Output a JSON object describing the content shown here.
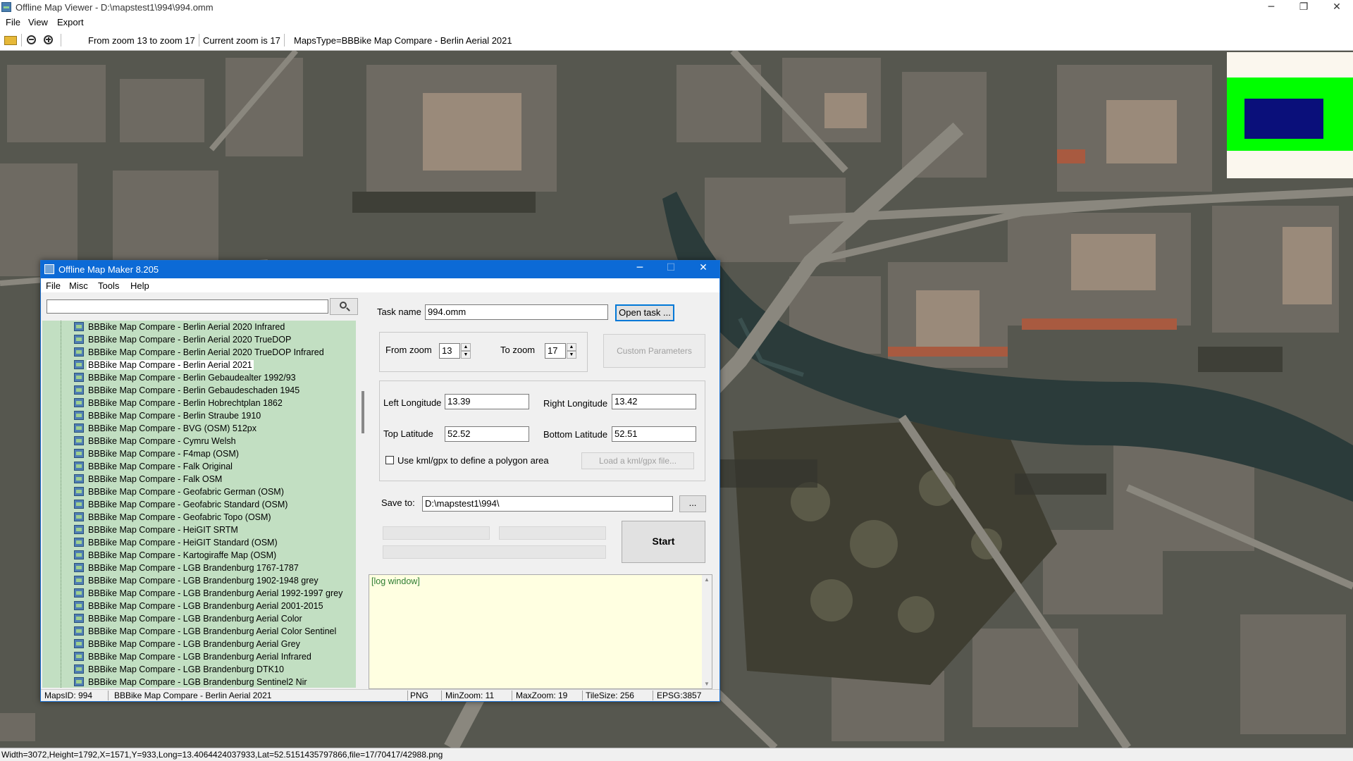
{
  "viewer": {
    "title": "Offline Map Viewer - D:\\mapstest1\\994\\994.omm",
    "menu": [
      "File",
      "View",
      "Export"
    ],
    "toolbar": {
      "zoom_range": "From zoom 13 to zoom 17",
      "current_zoom": "Current zoom is 17",
      "maps_type": "MapsType=BBBike Map Compare - Berlin Aerial 2021"
    },
    "status": "Width=3072,Height=1792,X=1571,Y=933,Long=13.4064424037933,Lat=52.5151435797866,file=17/70417/42988.png",
    "window_buttons": {
      "minimize": "─",
      "restore": "❐",
      "close": "✕"
    }
  },
  "minimap_colors": {
    "background": "#fbf7ee",
    "area": "#00ff00",
    "viewport": "#0a0f7a"
  },
  "omm": {
    "title": "Offline Map Maker 8.205",
    "menu": [
      "File",
      "Misc",
      "Tools",
      "Help"
    ],
    "search": {
      "value": ""
    },
    "tree_items": [
      "BBBike Map Compare - Berlin Aerial 2020 Infrared",
      "BBBike Map Compare - Berlin Aerial 2020 TrueDOP",
      "BBBike Map Compare - Berlin Aerial 2020 TrueDOP Infrared",
      "BBBike Map Compare - Berlin Aerial 2021",
      "BBBike Map Compare - Berlin Gebaudealter 1992/93",
      "BBBike Map Compare - Berlin Gebaudeschaden 1945",
      "BBBike Map Compare - Berlin Hobrechtplan 1862",
      "BBBike Map Compare - Berlin Straube 1910",
      "BBBike Map Compare - BVG (OSM) 512px",
      "BBBike Map Compare - Cymru Welsh",
      "BBBike Map Compare - F4map (OSM)",
      "BBBike Map Compare - Falk Original",
      "BBBike Map Compare - Falk OSM",
      "BBBike Map Compare - Geofabric German (OSM)",
      "BBBike Map Compare - Geofabric Standard (OSM)",
      "BBBike Map Compare - Geofabric Topo (OSM)",
      "BBBike Map Compare - HeiGIT SRTM",
      "BBBike Map Compare - HeiGIT Standard (OSM)",
      "BBBike Map Compare - Kartogiraffe Map (OSM)",
      "BBBike Map Compare - LGB Brandenburg 1767-1787",
      "BBBike Map Compare - LGB Brandenburg 1902-1948 grey",
      "BBBike Map Compare - LGB Brandenburg Aerial 1992-1997 grey",
      "BBBike Map Compare - LGB Brandenburg Aerial 2001-2015",
      "BBBike Map Compare - LGB Brandenburg Aerial Color",
      "BBBike Map Compare - LGB Brandenburg Aerial Color Sentinel",
      "BBBike Map Compare - LGB Brandenburg Aerial Grey",
      "BBBike Map Compare - LGB Brandenburg Aerial Infrared",
      "BBBike Map Compare - LGB Brandenburg DTK10",
      "BBBike Map Compare - LGB Brandenburg Sentinel2 Nir"
    ],
    "selected_index": 3,
    "task_name_label": "Task name",
    "task_name_value": "994.omm",
    "open_task_button": "Open task ...",
    "from_zoom_label": "From zoom",
    "from_zoom_value": "13",
    "to_zoom_label": "To zoom",
    "to_zoom_value": "17",
    "custom_params_button": "Custom Parameters",
    "left_longitude_label": "Left Longitude",
    "left_longitude_value": "13.39",
    "right_longitude_label": "Right Longitude",
    "right_longitude_value": "13.42",
    "top_latitude_label": "Top Latitude",
    "top_latitude_value": "52.52",
    "bottom_latitude_label": "Bottom Latitude",
    "bottom_latitude_value": "52.51",
    "kml_checkbox_label": "Use kml/gpx to define a polygon area",
    "kml_checked": false,
    "load_kml_button": "Load a kml/gpx file...",
    "save_to_label": "Save to:",
    "save_to_value": "D:\\mapstest1\\994\\",
    "browse_button": "...",
    "start_button": "Start",
    "log_text": "[log window]",
    "status": {
      "maps_id": "MapsID: 994",
      "maps_name": "BBBike Map Compare - Berlin Aerial 2021",
      "format": "PNG",
      "min_zoom": "MinZoom: 11",
      "max_zoom": "MaxZoom: 19",
      "tile_size": "TileSize: 256",
      "epsg": "EPSG:3857"
    }
  }
}
